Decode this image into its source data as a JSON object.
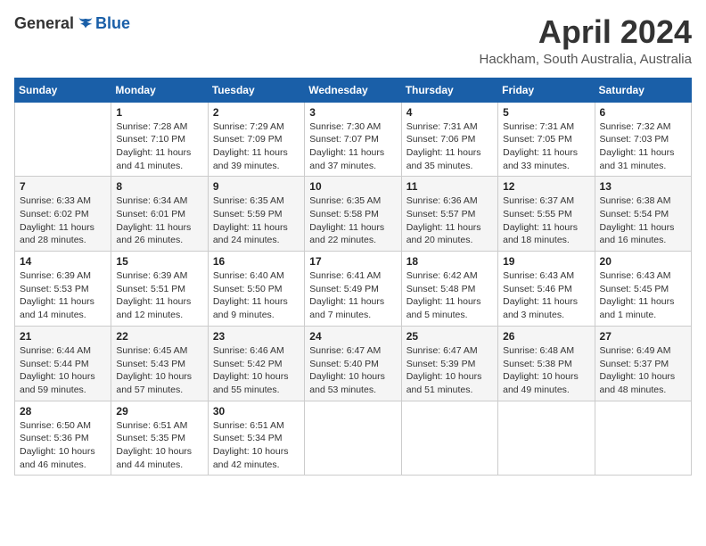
{
  "header": {
    "logo_general": "General",
    "logo_blue": "Blue",
    "month_title": "April 2024",
    "location": "Hackham, South Australia, Australia"
  },
  "days_of_week": [
    "Sunday",
    "Monday",
    "Tuesday",
    "Wednesday",
    "Thursday",
    "Friday",
    "Saturday"
  ],
  "weeks": [
    [
      {
        "day": "",
        "info": ""
      },
      {
        "day": "1",
        "info": "Sunrise: 7:28 AM\nSunset: 7:10 PM\nDaylight: 11 hours\nand 41 minutes."
      },
      {
        "day": "2",
        "info": "Sunrise: 7:29 AM\nSunset: 7:09 PM\nDaylight: 11 hours\nand 39 minutes."
      },
      {
        "day": "3",
        "info": "Sunrise: 7:30 AM\nSunset: 7:07 PM\nDaylight: 11 hours\nand 37 minutes."
      },
      {
        "day": "4",
        "info": "Sunrise: 7:31 AM\nSunset: 7:06 PM\nDaylight: 11 hours\nand 35 minutes."
      },
      {
        "day": "5",
        "info": "Sunrise: 7:31 AM\nSunset: 7:05 PM\nDaylight: 11 hours\nand 33 minutes."
      },
      {
        "day": "6",
        "info": "Sunrise: 7:32 AM\nSunset: 7:03 PM\nDaylight: 11 hours\nand 31 minutes."
      }
    ],
    [
      {
        "day": "7",
        "info": "Sunrise: 6:33 AM\nSunset: 6:02 PM\nDaylight: 11 hours\nand 28 minutes."
      },
      {
        "day": "8",
        "info": "Sunrise: 6:34 AM\nSunset: 6:01 PM\nDaylight: 11 hours\nand 26 minutes."
      },
      {
        "day": "9",
        "info": "Sunrise: 6:35 AM\nSunset: 5:59 PM\nDaylight: 11 hours\nand 24 minutes."
      },
      {
        "day": "10",
        "info": "Sunrise: 6:35 AM\nSunset: 5:58 PM\nDaylight: 11 hours\nand 22 minutes."
      },
      {
        "day": "11",
        "info": "Sunrise: 6:36 AM\nSunset: 5:57 PM\nDaylight: 11 hours\nand 20 minutes."
      },
      {
        "day": "12",
        "info": "Sunrise: 6:37 AM\nSunset: 5:55 PM\nDaylight: 11 hours\nand 18 minutes."
      },
      {
        "day": "13",
        "info": "Sunrise: 6:38 AM\nSunset: 5:54 PM\nDaylight: 11 hours\nand 16 minutes."
      }
    ],
    [
      {
        "day": "14",
        "info": "Sunrise: 6:39 AM\nSunset: 5:53 PM\nDaylight: 11 hours\nand 14 minutes."
      },
      {
        "day": "15",
        "info": "Sunrise: 6:39 AM\nSunset: 5:51 PM\nDaylight: 11 hours\nand 12 minutes."
      },
      {
        "day": "16",
        "info": "Sunrise: 6:40 AM\nSunset: 5:50 PM\nDaylight: 11 hours\nand 9 minutes."
      },
      {
        "day": "17",
        "info": "Sunrise: 6:41 AM\nSunset: 5:49 PM\nDaylight: 11 hours\nand 7 minutes."
      },
      {
        "day": "18",
        "info": "Sunrise: 6:42 AM\nSunset: 5:48 PM\nDaylight: 11 hours\nand 5 minutes."
      },
      {
        "day": "19",
        "info": "Sunrise: 6:43 AM\nSunset: 5:46 PM\nDaylight: 11 hours\nand 3 minutes."
      },
      {
        "day": "20",
        "info": "Sunrise: 6:43 AM\nSunset: 5:45 PM\nDaylight: 11 hours\nand 1 minute."
      }
    ],
    [
      {
        "day": "21",
        "info": "Sunrise: 6:44 AM\nSunset: 5:44 PM\nDaylight: 10 hours\nand 59 minutes."
      },
      {
        "day": "22",
        "info": "Sunrise: 6:45 AM\nSunset: 5:43 PM\nDaylight: 10 hours\nand 57 minutes."
      },
      {
        "day": "23",
        "info": "Sunrise: 6:46 AM\nSunset: 5:42 PM\nDaylight: 10 hours\nand 55 minutes."
      },
      {
        "day": "24",
        "info": "Sunrise: 6:47 AM\nSunset: 5:40 PM\nDaylight: 10 hours\nand 53 minutes."
      },
      {
        "day": "25",
        "info": "Sunrise: 6:47 AM\nSunset: 5:39 PM\nDaylight: 10 hours\nand 51 minutes."
      },
      {
        "day": "26",
        "info": "Sunrise: 6:48 AM\nSunset: 5:38 PM\nDaylight: 10 hours\nand 49 minutes."
      },
      {
        "day": "27",
        "info": "Sunrise: 6:49 AM\nSunset: 5:37 PM\nDaylight: 10 hours\nand 48 minutes."
      }
    ],
    [
      {
        "day": "28",
        "info": "Sunrise: 6:50 AM\nSunset: 5:36 PM\nDaylight: 10 hours\nand 46 minutes."
      },
      {
        "day": "29",
        "info": "Sunrise: 6:51 AM\nSunset: 5:35 PM\nDaylight: 10 hours\nand 44 minutes."
      },
      {
        "day": "30",
        "info": "Sunrise: 6:51 AM\nSunset: 5:34 PM\nDaylight: 10 hours\nand 42 minutes."
      },
      {
        "day": "",
        "info": ""
      },
      {
        "day": "",
        "info": ""
      },
      {
        "day": "",
        "info": ""
      },
      {
        "day": "",
        "info": ""
      }
    ]
  ]
}
